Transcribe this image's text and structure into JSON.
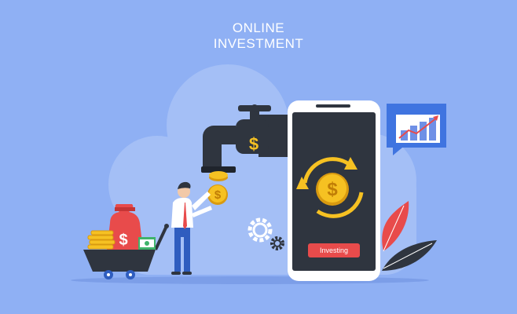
{
  "header": {
    "line1": "ONLINE",
    "line2": "INVESTMENT"
  },
  "phone": {
    "button_label": "Investing"
  },
  "icons": {
    "currency_symbol": "$"
  },
  "colors": {
    "background": "#8fb0f4",
    "cloud": "#a4bff6",
    "dark": "#2f353f",
    "coin": "#f6c122",
    "accent_red": "#e84b4b",
    "chart_blue": "#3f74e0"
  }
}
